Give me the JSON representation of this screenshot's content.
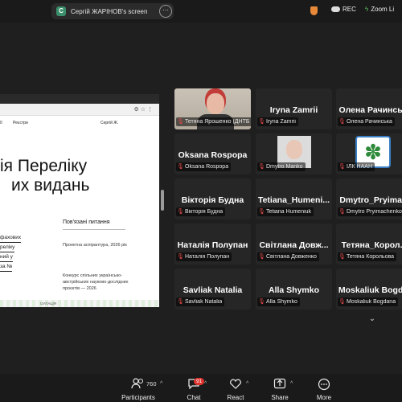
{
  "top": {
    "screen_tab_title": "Сергій ЖАРІНОВ's screen",
    "screen_tab_icon": "C",
    "rec": "REC",
    "live": "Zoom Li"
  },
  "shared_screen": {
    "nav_left": "0",
    "nav_item": "Реєстри",
    "user": "Сергій Ж.",
    "heading_line1": "ія Переліку",
    "heading_line2": "их видань",
    "left_link_lines": [
      "фахових",
      "реліку",
      "ний у",
      "за №"
    ],
    "side_title": "Пов'язані питання",
    "side_item1": "Проектна аспірантура, 2026 рік",
    "side_item2": "Конкурс спільних українсько-австрійських науково-дослідних проєктів — 2026",
    "footer": "ІЗАТАЦІЯ"
  },
  "participants": [
    {
      "big": "",
      "label": "Тетяна Ярошенко (ДНТБ ...",
      "video": "photo"
    },
    {
      "big": "Iryna Zamrii",
      "label": "Iryna Zamrii"
    },
    {
      "big": "Олена Рачинсь...",
      "label": "Олена Рачинська"
    },
    {
      "big": "Oksana Rospopa",
      "label": "Oksana Rospopa"
    },
    {
      "big": "",
      "label": "Dmytro Manko",
      "video": "avatar"
    },
    {
      "big": "",
      "label": "ІЛК НААН",
      "video": "logo"
    },
    {
      "big": "Вікторія Будна",
      "label": "Вікторія Будна"
    },
    {
      "big": "Tetiana_Humeni...",
      "label": "Tetiana Humeniuk"
    },
    {
      "big": "Dmytro_Pryima...",
      "label": "Dmytro Pryimachenko"
    },
    {
      "big": "Наталія Полупан",
      "label": "Наталія Полупан"
    },
    {
      "big": "Світлана Довж...",
      "label": "Світлана Довженко"
    },
    {
      "big": "Тетяна_Корол...",
      "label": "Тетяна Корольова"
    },
    {
      "big": "Savliak Natalia",
      "label": "Savliak Natalia"
    },
    {
      "big": "Alla Shymko",
      "label": "Alla Shymko"
    },
    {
      "big": "Moskaliuk Bogd...",
      "label": "Moskaliuk Bogdana"
    }
  ],
  "toolbar": {
    "participants_label": "Participants",
    "participants_count": "760",
    "chat_label": "Chat",
    "chat_badge": "91",
    "react_label": "React",
    "share_label": "Share",
    "more_label": "More"
  },
  "colors": {
    "background": "#1f1f1f",
    "tile": "#262626",
    "mic_muted": "#e24a4a",
    "badge": "#e0342f"
  }
}
